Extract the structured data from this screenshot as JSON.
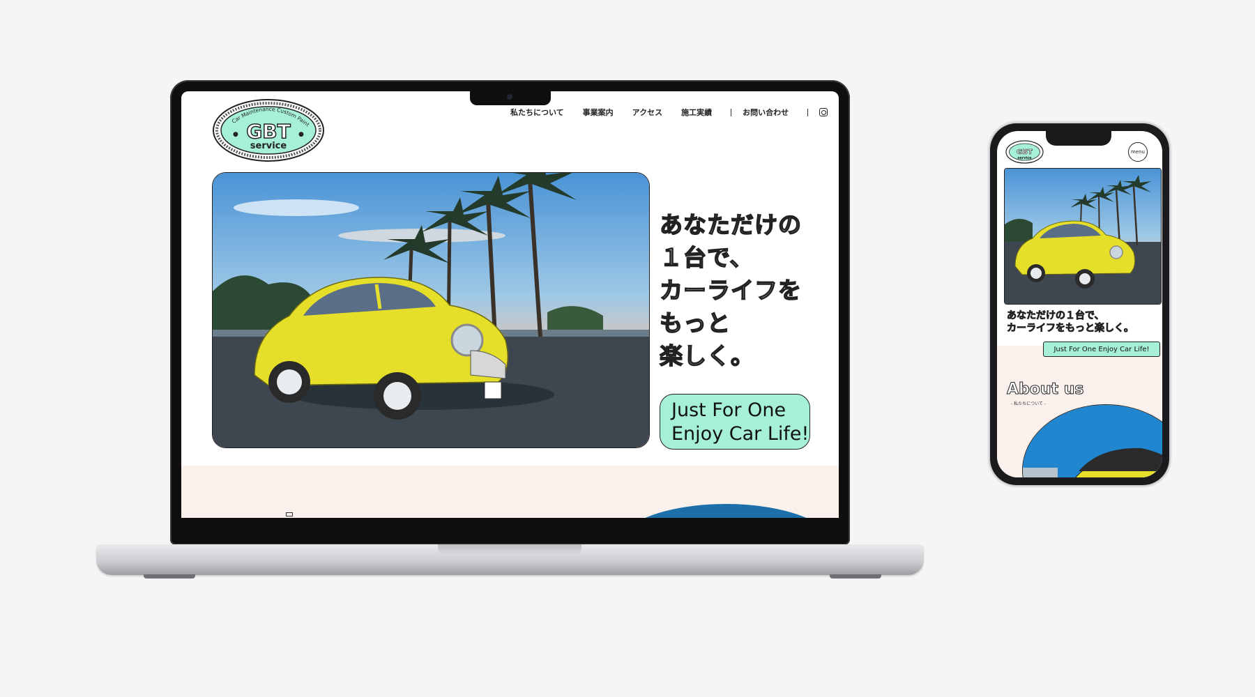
{
  "laptop_site": {
    "logo": {
      "main": "GBT",
      "sub": "service",
      "arc": "Car Maintenance Custom Paint"
    },
    "nav": {
      "items": [
        "私たちについて",
        "事業案内",
        "アクセス",
        "施工実績",
        "お問い合わせ"
      ],
      "instagram_icon": "instagram-icon"
    },
    "hero_headline": [
      "あなただけの",
      "１台で、",
      "カーライフを",
      "もっと",
      "楽しく。"
    ],
    "tagline": [
      "Just For One",
      "Enjoy Car Life!"
    ]
  },
  "phone_site": {
    "logo": {
      "main": "GBT",
      "sub": "service"
    },
    "menu_label": "menu",
    "headline": [
      "あなただけの１台で、",
      "カーライフをもっと楽しく。"
    ],
    "tagline": "Just For One Enjoy Car Life!",
    "about_title": "About us",
    "about_sub": "- 私たちについて -"
  },
  "colors": {
    "mint": "#a6f0d8",
    "cream": "#fbf1ec",
    "car_yellow": "#e6df2a",
    "ink": "#222222"
  }
}
